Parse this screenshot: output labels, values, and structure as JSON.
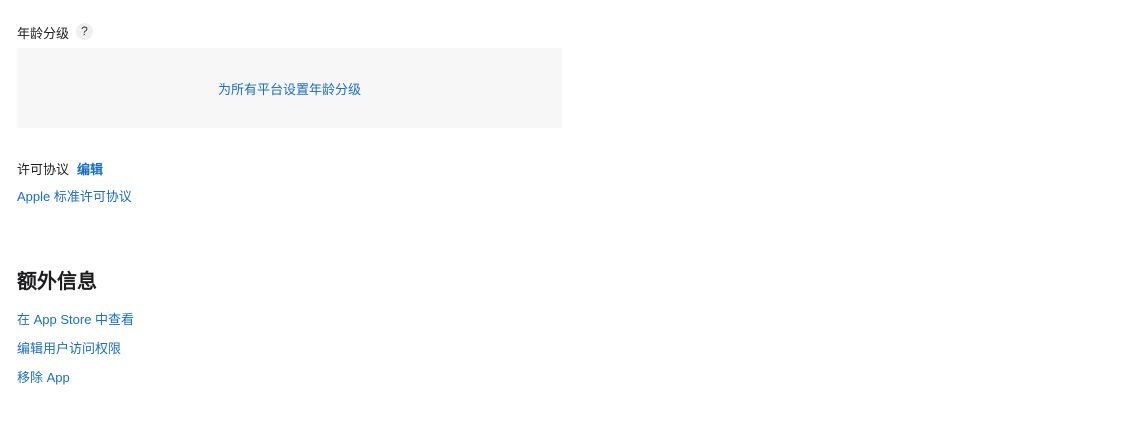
{
  "age_rating": {
    "label": "年龄分级",
    "help_glyph": "?",
    "set_all_link": "为所有平台设置年龄分级"
  },
  "license": {
    "label": "许可协议",
    "edit_link": "编辑",
    "value_link": "Apple 标准许可协议"
  },
  "additional_info": {
    "title": "额外信息",
    "links": [
      "在 App Store 中查看",
      "编辑用户访问权限",
      "移除 App"
    ]
  },
  "colors": {
    "link": "#1a6fc2",
    "box_background": "#f7f7f7",
    "text": "#1d1d1f"
  }
}
